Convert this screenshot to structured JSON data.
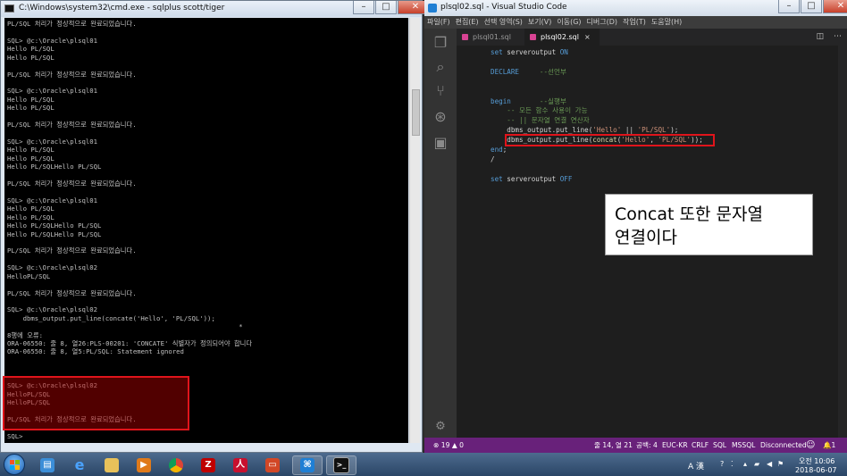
{
  "cmd": {
    "title": "C:\\Windows\\system32\\cmd.exe - sqlplus  scott/tiger",
    "lines": [
      "PL/SQL 처리가 정상적으로 완료되었습니다.",
      "",
      "SQL> @c:\\Oracle\\plsql01",
      "Hello PL/SQL",
      "Hello PL/SQL",
      "",
      "PL/SQL 처리가 정상적으로 완료되었습니다.",
      "",
      "SQL> @c:\\Oracle\\plsql01",
      "Hello PL/SQL",
      "Hello PL/SQL",
      "",
      "PL/SQL 처리가 정상적으로 완료되었습니다.",
      "",
      "SQL> @c:\\Oracle\\plsql01",
      "Hello PL/SQL",
      "Hello PL/SQL",
      "Hello PL/SQLHello PL/SQL",
      "",
      "PL/SQL 처리가 정상적으로 완료되었습니다.",
      "",
      "SQL> @c:\\Oracle\\plsql01",
      "Hello PL/SQL",
      "Hello PL/SQL",
      "Hello PL/SQLHello PL/SQL",
      "Hello PL/SQLHello PL/SQL",
      "",
      "PL/SQL 처리가 정상적으로 완료되었습니다.",
      "",
      "SQL> @c:\\Oracle\\plsql02",
      "HelloPL/SQL",
      "",
      "PL/SQL 처리가 정상적으로 완료되었습니다.",
      "",
      "SQL> @c:\\Oracle\\plsql02",
      "    dbms_output.put_line(concate('Hello', 'PL/SQL'));",
      "                                                           *",
      "8행에 오류:",
      "ORA-06550: 줄 8, 열26:PLS-00201: 'CONCATE' 식별자가 정의되어야 합니다",
      "ORA-06550: 줄 8, 열5:PL/SQL: Statement ignored",
      "",
      "",
      "",
      "SQL> @c:\\Oracle\\plsql02",
      "HelloPL/SQL",
      "HelloPL/SQL",
      "",
      "PL/SQL 처리가 정상적으로 완료되었습니다.",
      "",
      "SQL>"
    ]
  },
  "vscode": {
    "title": "plsql02.sql - Visual Studio Code",
    "menu": [
      "파일(F)",
      "편집(E)",
      "선택 영역(S)",
      "보기(V)",
      "이동(G)",
      "디버그(D)",
      "작업(T)",
      "도움말(H)"
    ],
    "tabs": [
      {
        "label": "plsql01.sql"
      },
      {
        "label": "plsql02.sql",
        "close": "×"
      }
    ],
    "code": [
      {
        "n": "1",
        "parts": [
          [
            "kw",
            "set "
          ],
          [
            "pl",
            "serveroutput "
          ],
          [
            "kw",
            "ON"
          ]
        ]
      },
      {
        "n": "2",
        "parts": []
      },
      {
        "n": "3",
        "parts": [
          [
            "kw",
            "DECLARE"
          ],
          [
            "pl",
            "     "
          ],
          [
            "cm",
            "--선언부"
          ]
        ]
      },
      {
        "n": "4",
        "parts": []
      },
      {
        "n": "5",
        "parts": []
      },
      {
        "n": "6",
        "parts": [
          [
            "kw",
            "begin"
          ],
          [
            "pl",
            "       "
          ],
          [
            "cm",
            "--실행부"
          ]
        ]
      },
      {
        "n": "7",
        "parts": [
          [
            "pl",
            "    "
          ],
          [
            "cm",
            "-- 모든 함수 사용이 가능"
          ]
        ]
      },
      {
        "n": "8",
        "parts": [
          [
            "pl",
            "    "
          ],
          [
            "cm",
            "-- || 문자열 연결 연산자"
          ]
        ]
      },
      {
        "n": "9",
        "parts": [
          [
            "pl",
            "    dbms_output.put_line("
          ],
          [
            "str",
            "'Hello'"
          ],
          [
            "pl",
            " || "
          ],
          [
            "str",
            "'PL/SQL'"
          ],
          [
            "pl",
            ");"
          ]
        ]
      },
      {
        "n": "10",
        "parts": [
          [
            "pl",
            "    dbms_output.put_line("
          ],
          [
            "fn",
            "concat"
          ],
          [
            "pl",
            "("
          ],
          [
            "str",
            "'Hello'"
          ],
          [
            "pl",
            ", "
          ],
          [
            "str",
            "'PL/SQL'"
          ],
          [
            "pl",
            "));"
          ]
        ]
      },
      {
        "n": "11",
        "parts": [
          [
            "kw",
            "end"
          ],
          [
            "pl",
            ";"
          ]
        ]
      },
      {
        "n": "12",
        "parts": [
          [
            "pl",
            "/"
          ]
        ]
      },
      {
        "n": "13",
        "parts": []
      },
      {
        "n": "14",
        "parts": [
          [
            "kw",
            "set "
          ],
          [
            "pl",
            "serveroutput "
          ],
          [
            "kw",
            "OFF"
          ]
        ]
      }
    ],
    "annotation": [
      "Concat 또한 문자열",
      "연결이다"
    ],
    "status": {
      "problems": "⊗ 19 ▲ 0",
      "position": "줄 14, 열 21",
      "spaces": "공백: 4",
      "encoding": "EUC-KR",
      "eol": "CRLF",
      "language": "SQL",
      "dialect": "MSSQL",
      "connection": "Disconnected",
      "smile": "☺",
      "bell": "🔔1"
    }
  },
  "tray": {
    "ime": "A 漢",
    "time": "오전 10:06",
    "date": "2018-06-07"
  },
  "colors": {
    "status_bar": "#68217a",
    "highlight": "#e0141b"
  }
}
